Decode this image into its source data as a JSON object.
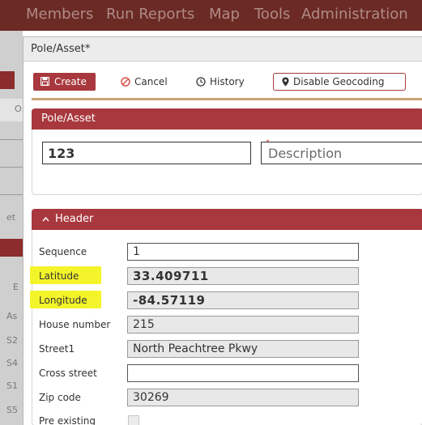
{
  "topnav": {
    "items": [
      "Members",
      "Run Reports",
      "Map",
      "Tools",
      "Administration"
    ]
  },
  "background_labels": [
    "O:",
    "et",
    "E",
    "As",
    "S2",
    "S4",
    "S1",
    "S5"
  ],
  "dialog": {
    "title": "Pole/Asset*"
  },
  "toolbar": {
    "create_label": "Create",
    "cancel_label": "Cancel",
    "history_label": "History",
    "geocoding_label": "Disable Geocoding"
  },
  "pole_panel": {
    "title": "Pole/Asset",
    "id_value": "123",
    "description_placeholder": "Description"
  },
  "header_panel": {
    "title": "Header",
    "fields": [
      {
        "label": "Sequence",
        "value": "1"
      },
      {
        "label": "Latitude",
        "value": "33.409711"
      },
      {
        "label": "Longitude",
        "value": "-84.57119"
      },
      {
        "label": "House number",
        "value": "215"
      },
      {
        "label": "Street1",
        "value": "North Peachtree Pkwy"
      },
      {
        "label": "Cross street",
        "value": ""
      },
      {
        "label": "Zip code",
        "value": "30269"
      },
      {
        "label": "Pre existing",
        "value": ""
      }
    ]
  },
  "colors": {
    "brand": "#a8383d",
    "highlight": "#f4f42a",
    "nav": "#6b2a24"
  }
}
